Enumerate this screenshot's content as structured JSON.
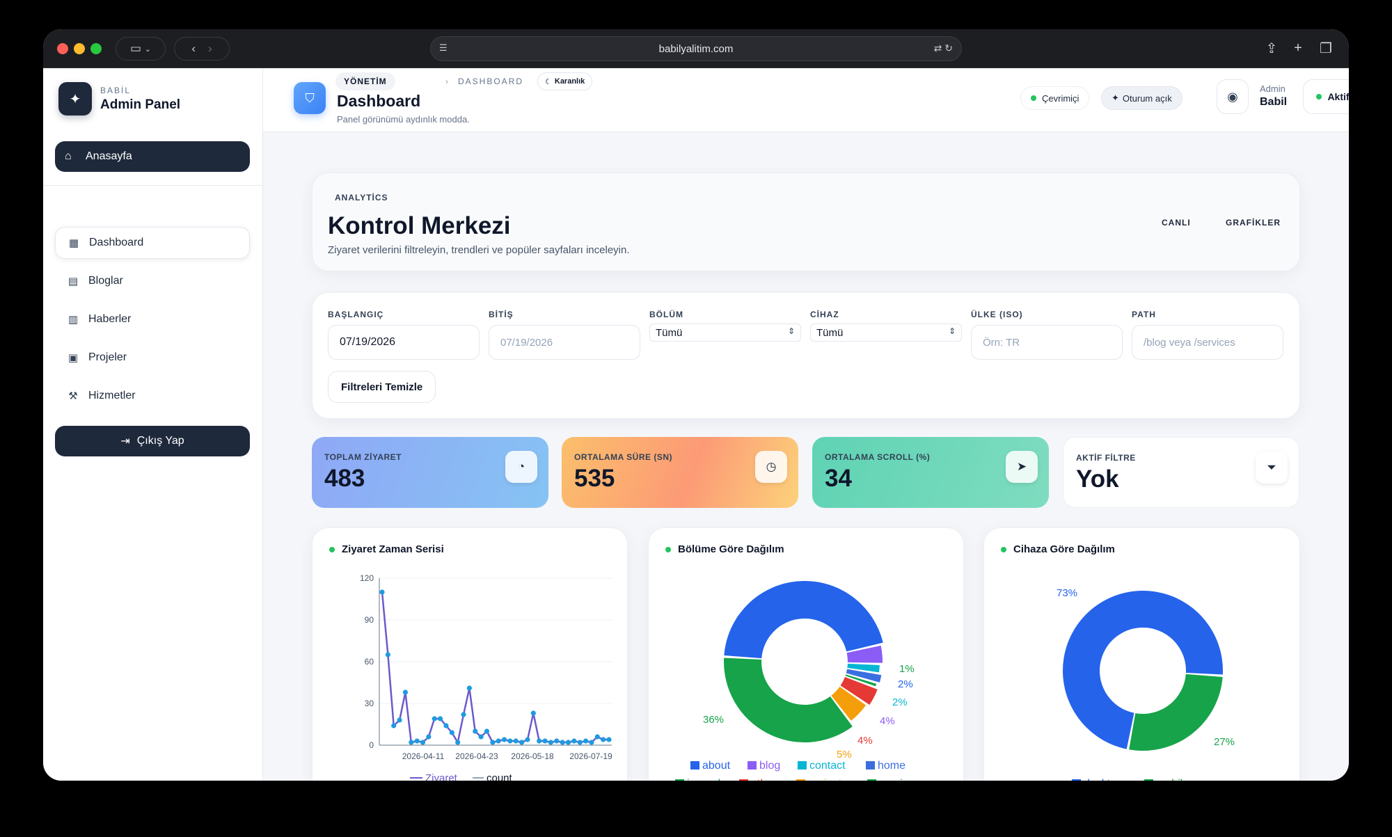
{
  "browser": {
    "url": "babilyalitim.com",
    "colors": {
      "close": "#ff5f57",
      "minimize": "#febc2e",
      "zoom": "#28c840"
    }
  },
  "sidebar": {
    "brand_small": "BABİL",
    "brand_title": "Admin Panel",
    "home_label": "Anasayfa",
    "items": [
      {
        "label": "Dashboard",
        "icon": "grid-icon"
      },
      {
        "label": "Bloglar",
        "icon": "document-icon"
      },
      {
        "label": "Haberler",
        "icon": "newspaper-icon"
      },
      {
        "label": "Projeler",
        "icon": "chart-frame-icon"
      },
      {
        "label": "Hizmetler",
        "icon": "wrench-icon"
      }
    ],
    "logout_label": "Çıkış Yap"
  },
  "header": {
    "crumb_root": "YÖNETİM",
    "crumb_leaf": "DASHBOARD",
    "theme_label": "Karanlık",
    "title": "Dashboard",
    "subtitle": "Panel görünümü aydınlık modda.",
    "online_label": "Çevrimiçi",
    "session_label": "Oturum açık",
    "user_role": "Admin",
    "user_name": "Babil",
    "status_label": "Aktif"
  },
  "hero": {
    "eyebrow": "ANALYTİCS",
    "title": "Kontrol Merkezi",
    "subtitle": "Ziyaret verilerini filtreleyin, trendleri ve popüler sayfaları inceleyin.",
    "tab_live": "CANLI",
    "tab_charts": "GRAFİKLER"
  },
  "filters": {
    "start_label": "BAŞLANGIÇ",
    "start_value": "07/19/2026",
    "end_label": "BİTİŞ",
    "end_placeholder": "07/19/2026",
    "section_label": "BÖLÜM",
    "section_value": "Tümü",
    "device_label": "CİHAZ",
    "device_value": "Tümü",
    "country_label": "ÜLKE (ISO)",
    "country_placeholder": "Örn: TR",
    "path_label": "PATH",
    "path_placeholder": "/blog veya /services",
    "clear_label": "Filtreleri Temizle"
  },
  "stats": [
    {
      "label": "TOPLAM ZİYARET",
      "value": "483",
      "icon": "gauge-icon"
    },
    {
      "label": "ORTALAMA SÜRE (SN)",
      "value": "535",
      "icon": "stopwatch-icon"
    },
    {
      "label": "ORTALAMA SCROLL (%)",
      "value": "34",
      "icon": "cursor-icon"
    },
    {
      "label": "AKTİF FİLTRE",
      "value": "Yok",
      "icon": "filter-icon"
    }
  ],
  "charts": {
    "line_title": "Ziyaret Zaman Serisi",
    "section_title": "Bölüme Göre Dağılım",
    "device_title": "Cihaza Göre Dağılım"
  },
  "chart_data": [
    {
      "type": "line",
      "title": "Ziyaret Zaman Serisi",
      "ylim": [
        0,
        120
      ],
      "yticks": [
        0,
        30,
        60,
        90,
        120
      ],
      "xtick_labels": [
        "2026-04-11",
        "2026-04-23",
        "2026-05-18",
        "2026-07-19"
      ],
      "series": [
        {
          "name": "Ziyaret",
          "color": "#6a5acd",
          "values": [
            110,
            65,
            14,
            18,
            38,
            2,
            3,
            2,
            6,
            19,
            19,
            14,
            9,
            2,
            22,
            41,
            10,
            6,
            10,
            2,
            3,
            4,
            3,
            3,
            2,
            4,
            23,
            3,
            3,
            2,
            3,
            2,
            2,
            3,
            2,
            3,
            2,
            6,
            4,
            4
          ]
        },
        {
          "name": "count",
          "color": "#94a3b8",
          "values": []
        }
      ]
    },
    {
      "type": "pie",
      "title": "Bölüme Göre Dağılım",
      "categories": [
        "about",
        "blog",
        "contact",
        "home",
        "journal",
        "other",
        "projects",
        "services"
      ],
      "values": [
        45,
        4,
        2,
        2,
        1,
        4,
        5,
        36
      ],
      "colors": [
        "#2563eb",
        "#8b5cf6",
        "#06b6d4",
        "#3b6fe0",
        "#14a34a",
        "#e53935",
        "#f59e0b",
        "#16a34a"
      ],
      "labels": [
        "1%",
        "2%",
        "2%",
        "4%",
        "4%",
        "5%",
        "36%"
      ]
    },
    {
      "type": "pie",
      "title": "Cihaza Göre Dağılım",
      "categories": [
        "desktop",
        "mobile"
      ],
      "values": [
        73,
        27
      ],
      "colors": [
        "#2563eb",
        "#16a34a"
      ],
      "labels": [
        "73%",
        "27%"
      ]
    }
  ]
}
